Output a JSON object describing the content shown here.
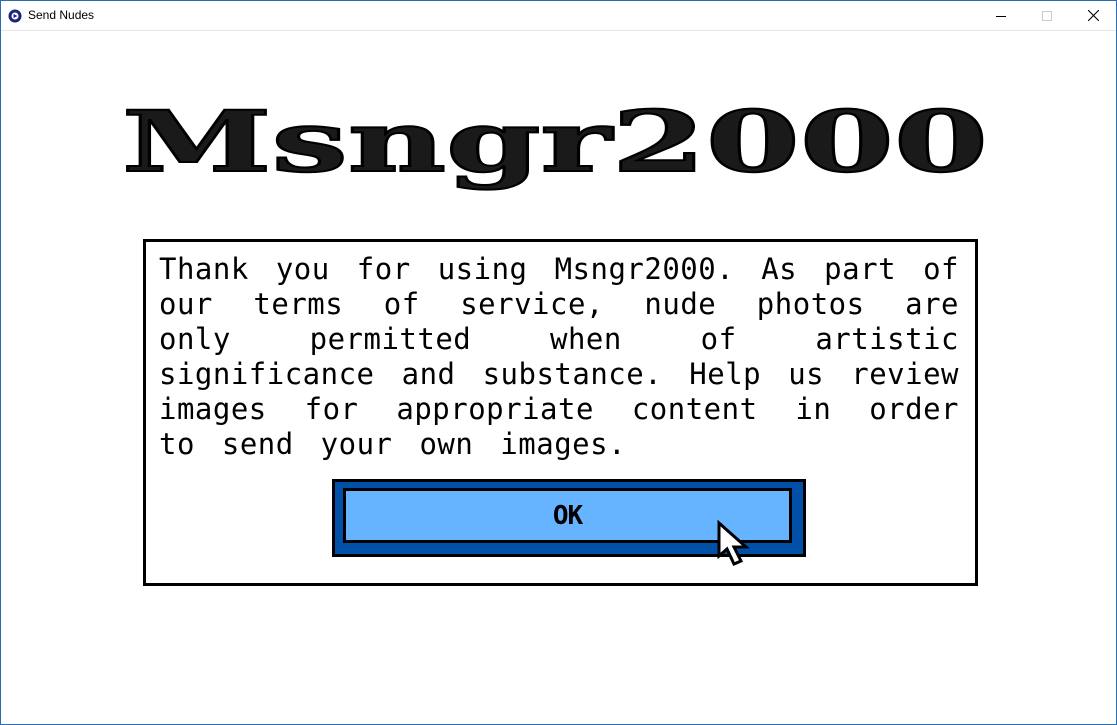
{
  "window": {
    "title": "Send Nudes",
    "icon": "messenger-app-icon",
    "controls": [
      "minimize-icon",
      "maximize-icon",
      "close-icon"
    ]
  },
  "logo": {
    "text": "Msngr2000",
    "color": "#000000"
  },
  "dialog": {
    "message": "Thank you for using Msngr2000. As part of our terms of service, nude photos are only permitted when of artistic significance and substance. Help us review images for appropriate content in order to send your own images.",
    "ok_label": "OK"
  },
  "colors": {
    "button_face": "#66b3ff",
    "button_frame": "#0050a8",
    "border": "#000000"
  },
  "cursor": "arrow-pointer-icon"
}
